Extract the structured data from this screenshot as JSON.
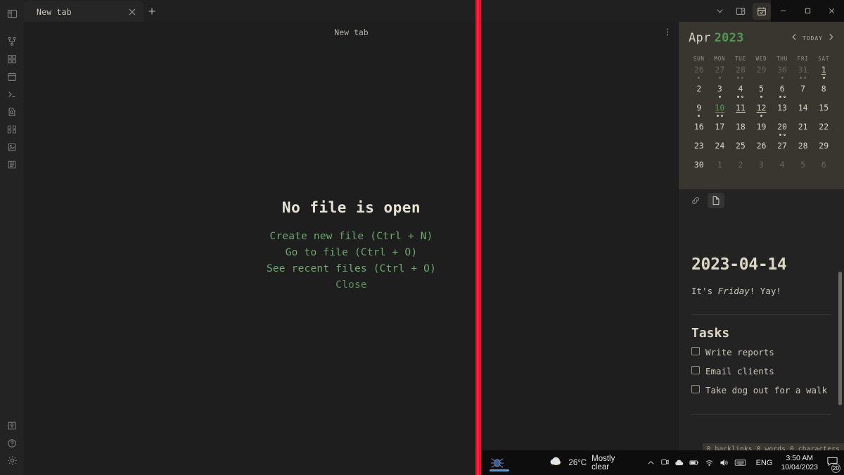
{
  "activitybar": {
    "toggle_icon": "sidebar-toggle-icon",
    "items": [
      {
        "icon": "git-branch-icon",
        "name": "git"
      },
      {
        "icon": "grid-dashboard-icon",
        "name": "dashboard"
      },
      {
        "icon": "calendar-icon",
        "name": "calendar"
      },
      {
        "icon": "terminal-icon",
        "name": "terminal"
      },
      {
        "icon": "file-search-icon",
        "name": "file-search"
      },
      {
        "icon": "binary-icon",
        "name": "binary"
      },
      {
        "icon": "image-icon",
        "name": "image"
      },
      {
        "icon": "list-icon",
        "name": "list"
      }
    ],
    "bottom_items": [
      {
        "icon": "key-lock-icon",
        "name": "vault"
      },
      {
        "icon": "help-icon",
        "name": "help"
      },
      {
        "icon": "gear-icon",
        "name": "settings"
      }
    ]
  },
  "tabstrip": {
    "tab_label": "New tab",
    "close_icon": "close-icon",
    "new_tab_icon": "plus-icon",
    "chevron_icon": "chevron-down-icon",
    "panel_toggle_icon": "right-panel-toggle-icon",
    "calendar_toggle_icon": "calendar-check-icon"
  },
  "window_controls": {
    "minimize": "minimize-icon",
    "maximize": "maximize-icon",
    "close": "close-icon"
  },
  "editor": {
    "header_title": "New tab",
    "kebab_icon": "more-options-icon",
    "empty_title": "No file is open",
    "actions": [
      "Create new file (Ctrl + N)",
      "Go to file (Ctrl + O)",
      "See recent files (Ctrl + O)",
      "Close"
    ]
  },
  "calendar": {
    "month": "Apr",
    "year": "2023",
    "prev_icon": "chevron-left-icon",
    "next_icon": "chevron-right-icon",
    "today_label": "TODAY",
    "weekdays": [
      "SUN",
      "MON",
      "TUE",
      "WED",
      "THU",
      "FRI",
      "SAT"
    ],
    "accent_color": "#4f9a52",
    "weeks": [
      [
        {
          "d": "26",
          "out": true,
          "dots": [
            "f"
          ]
        },
        {
          "d": "27",
          "out": true,
          "dots": [
            "f"
          ]
        },
        {
          "d": "28",
          "out": true,
          "dots": [
            "f",
            "o"
          ]
        },
        {
          "d": "29",
          "out": true,
          "dots": []
        },
        {
          "d": "30",
          "out": true,
          "dots": [
            "f"
          ]
        },
        {
          "d": "31",
          "out": true,
          "dots": [
            "f",
            "o"
          ]
        },
        {
          "d": "1",
          "out": false,
          "underline": true,
          "dots": [
            "f"
          ]
        }
      ],
      [
        {
          "d": "2",
          "out": false,
          "dots": []
        },
        {
          "d": "3",
          "out": false,
          "dots": [
            "f"
          ]
        },
        {
          "d": "4",
          "out": false,
          "dots": [
            "f",
            "o"
          ]
        },
        {
          "d": "5",
          "out": false,
          "dots": [
            "f"
          ]
        },
        {
          "d": "6",
          "out": false,
          "dots": [
            "f",
            "o"
          ]
        },
        {
          "d": "7",
          "out": false,
          "dots": []
        },
        {
          "d": "8",
          "out": false,
          "dots": []
        }
      ],
      [
        {
          "d": "9",
          "out": false,
          "dots": [
            "f"
          ]
        },
        {
          "d": "10",
          "out": false,
          "today": true,
          "underline": true,
          "dots": [
            "f",
            "o"
          ]
        },
        {
          "d": "11",
          "out": false,
          "underline": true,
          "dots": []
        },
        {
          "d": "12",
          "out": false,
          "underline": true,
          "dots": [
            "f"
          ]
        },
        {
          "d": "13",
          "out": false,
          "dots": []
        },
        {
          "d": "14",
          "out": false,
          "dots": []
        },
        {
          "d": "15",
          "out": false,
          "dots": []
        }
      ],
      [
        {
          "d": "16",
          "out": false,
          "dots": []
        },
        {
          "d": "17",
          "out": false,
          "dots": []
        },
        {
          "d": "18",
          "out": false,
          "dots": []
        },
        {
          "d": "19",
          "out": false,
          "dots": []
        },
        {
          "d": "20",
          "out": false,
          "dots": [
            "f",
            "o"
          ]
        },
        {
          "d": "21",
          "out": false,
          "dots": []
        },
        {
          "d": "22",
          "out": false,
          "dots": []
        }
      ],
      [
        {
          "d": "23",
          "out": false,
          "dots": []
        },
        {
          "d": "24",
          "out": false,
          "dots": []
        },
        {
          "d": "25",
          "out": false,
          "dots": []
        },
        {
          "d": "26",
          "out": false,
          "dots": []
        },
        {
          "d": "27",
          "out": false,
          "dots": []
        },
        {
          "d": "28",
          "out": false,
          "dots": []
        },
        {
          "d": "29",
          "out": false,
          "dots": []
        }
      ],
      [
        {
          "d": "30",
          "out": false,
          "dots": []
        },
        {
          "d": "1",
          "out": true,
          "dots": []
        },
        {
          "d": "2",
          "out": true,
          "dots": []
        },
        {
          "d": "3",
          "out": true,
          "dots": []
        },
        {
          "d": "4",
          "out": true,
          "dots": []
        },
        {
          "d": "5",
          "out": true,
          "dots": []
        },
        {
          "d": "6",
          "out": true,
          "dots": []
        }
      ]
    ]
  },
  "note_tabs": [
    {
      "icon": "backlinks-icon",
      "active": false
    },
    {
      "icon": "document-icon",
      "active": true
    }
  ],
  "note": {
    "date_title": "2023-04-14",
    "greeting_prefix": "It's ",
    "greeting_day": "Friday",
    "greeting_suffix": "! Yay!",
    "tasks_heading": "Tasks",
    "tasks": [
      {
        "label": "Write reports",
        "checked": false
      },
      {
        "label": "Email clients",
        "checked": false
      },
      {
        "label": "Take dog out for a walk",
        "checked": false
      }
    ],
    "status": "0 backlinks  0 words  0 characters"
  },
  "taskbar": {
    "app_icon": "bug-app-icon",
    "weather_icon": "partly-cloudy-icon",
    "temperature": "26°C",
    "condition": "Mostly clear",
    "tray_icons": [
      "chevron-up-icon",
      "webcam-icon",
      "cloud-icon",
      "battery-icon",
      "wifi-icon",
      "volume-icon",
      "keyboard-icon"
    ],
    "language": "ENG",
    "time": "3:50 AM",
    "date": "10/04/2023",
    "notification_icon": "notification-icon",
    "notification_count": "20"
  }
}
